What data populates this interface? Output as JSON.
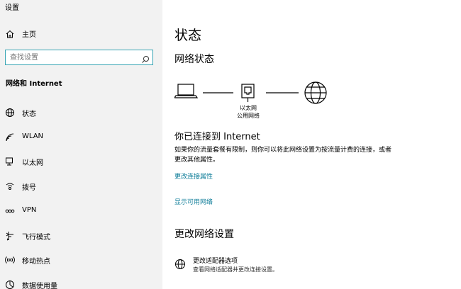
{
  "window": {
    "title": "设置"
  },
  "sidebar": {
    "home_label": "主页",
    "search_placeholder": "查找设置",
    "section_title": "网络和 Internet",
    "items": [
      {
        "label": "状态",
        "icon": "globe-icon"
      },
      {
        "label": "WLAN",
        "icon": "wifi-icon"
      },
      {
        "label": "以太网",
        "icon": "ethernet-icon"
      },
      {
        "label": "拨号",
        "icon": "dialup-icon"
      },
      {
        "label": "VPN",
        "icon": "vpn-icon"
      },
      {
        "label": "飞行模式",
        "icon": "airplane-icon"
      },
      {
        "label": "移动热点",
        "icon": "hotspot-icon"
      },
      {
        "label": "数据使用量",
        "icon": "data-usage-icon"
      }
    ]
  },
  "main": {
    "title": "状态",
    "network_status_heading": "网络状态",
    "diagram": {
      "adapter_name": "以太网",
      "network_type": "公用网络"
    },
    "connected_heading": "你已连接到 Internet",
    "description": "如果你的流量套餐有限制，则你可以将此网络设置为按流量计费的连接，或者更改其他属性。",
    "link_change_properties": "更改连接属性",
    "link_show_networks": "显示可用网络",
    "change_settings_heading": "更改网络设置",
    "adapter_option": {
      "title": "更改适配器选项",
      "subtitle": "查看网络适配器并更改连接设置。"
    }
  },
  "colors": {
    "accent": "#0f7d99",
    "search_border": "#35a3b3",
    "sidebar_bg": "#f2f2f2"
  }
}
